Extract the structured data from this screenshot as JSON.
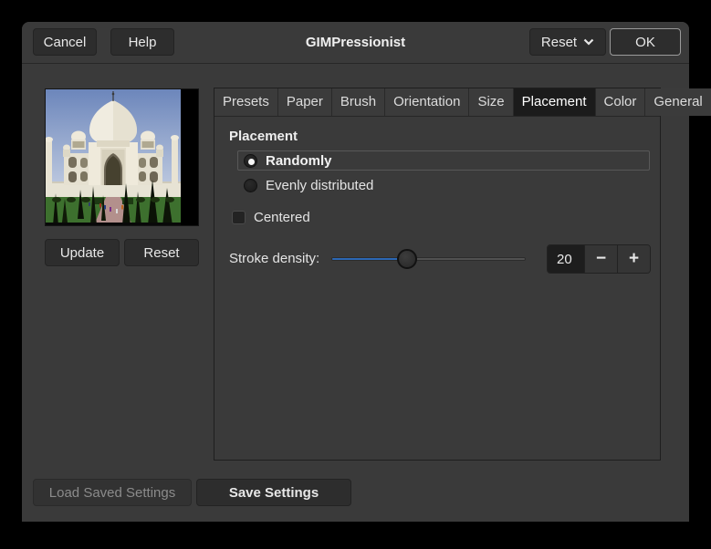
{
  "colors": {
    "accent_blue": "#2b67b4",
    "dialog_bg": "#3a3a3a",
    "outer_bg": "#000000"
  },
  "header": {
    "title": "GIMPressionist",
    "cancel": "Cancel",
    "help": "Help",
    "reset": "Reset",
    "ok": "OK"
  },
  "preview": {
    "update": "Update",
    "reset": "Reset"
  },
  "tabs": {
    "active": "Placement",
    "items": [
      {
        "label": "Presets"
      },
      {
        "label": "Paper"
      },
      {
        "label": "Brush"
      },
      {
        "label": "Orientation"
      },
      {
        "label": "Size"
      },
      {
        "label": "Placement"
      },
      {
        "label": "Color"
      },
      {
        "label": "General"
      }
    ]
  },
  "placement_panel": {
    "heading": "Placement",
    "radios": [
      {
        "label": "Randomly",
        "selected": true
      },
      {
        "label": "Evenly distributed",
        "selected": false
      }
    ],
    "centered_checkbox": {
      "label": "Centered",
      "checked": false
    },
    "stroke_density": {
      "label": "Stroke density:",
      "value": "20",
      "fill_percent": 39,
      "minus_glyph": "−",
      "plus_glyph": "+"
    }
  },
  "footer": {
    "load_saved": "Load Saved Settings",
    "load_saved_enabled": false,
    "save": "Save Settings"
  }
}
